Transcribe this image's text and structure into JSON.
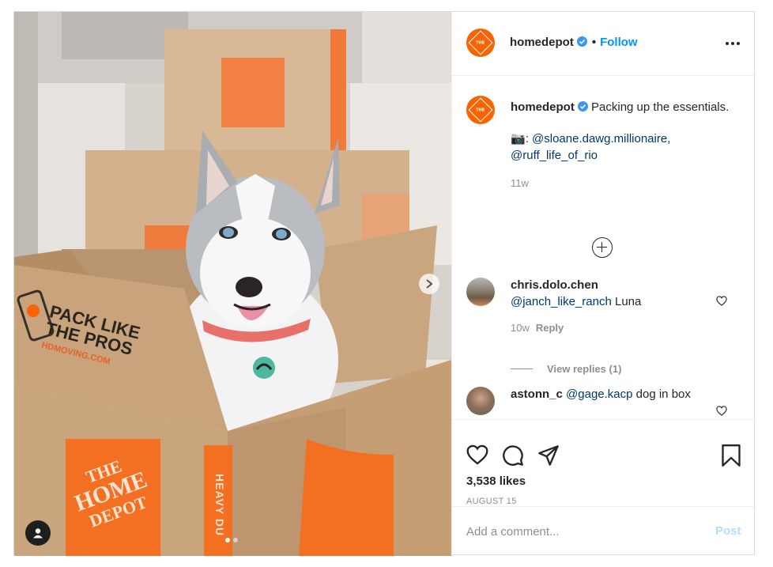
{
  "post": {
    "author": "homedepot",
    "follow_label": "Follow",
    "separator": "•",
    "more_icon": "more-options-icon",
    "brand_color": "#f96302",
    "link_color": "#00376b",
    "accent_color": "#0095f6"
  },
  "photo": {
    "box_slogan_line1": "PACK LIKE",
    "box_slogan_line2": "THE PROS",
    "box_url": "HDMOVING.COM",
    "box_side_text": "HEAVY DU",
    "box_logo_text_1": "THE",
    "box_logo_text_2": "HOME",
    "box_logo_text_3": "DEPOT",
    "carousel_total": 2,
    "carousel_active": 1
  },
  "caption": {
    "username": "homedepot",
    "text": "Packing up the essentials.",
    "camera_emoji": "📷",
    "colon": ":",
    "mention1": "@sloane.dawg.millionaire,",
    "mention2": "@ruff_life_of_rio",
    "time": "11w"
  },
  "comments": [
    {
      "username": "chris.dolo.chen",
      "mention": "@janch_like_ranch",
      "text": "Luna",
      "time": "10w",
      "reply_label": "Reply",
      "view_replies": "View replies (1)"
    },
    {
      "username": "astonn_c",
      "mention": "@gage.kacp",
      "text": "dog in box"
    }
  ],
  "actions": {
    "likes": "3,538 likes",
    "date": "AUGUST 15"
  },
  "add_comment": {
    "placeholder": "Add a comment...",
    "post_label": "Post"
  }
}
